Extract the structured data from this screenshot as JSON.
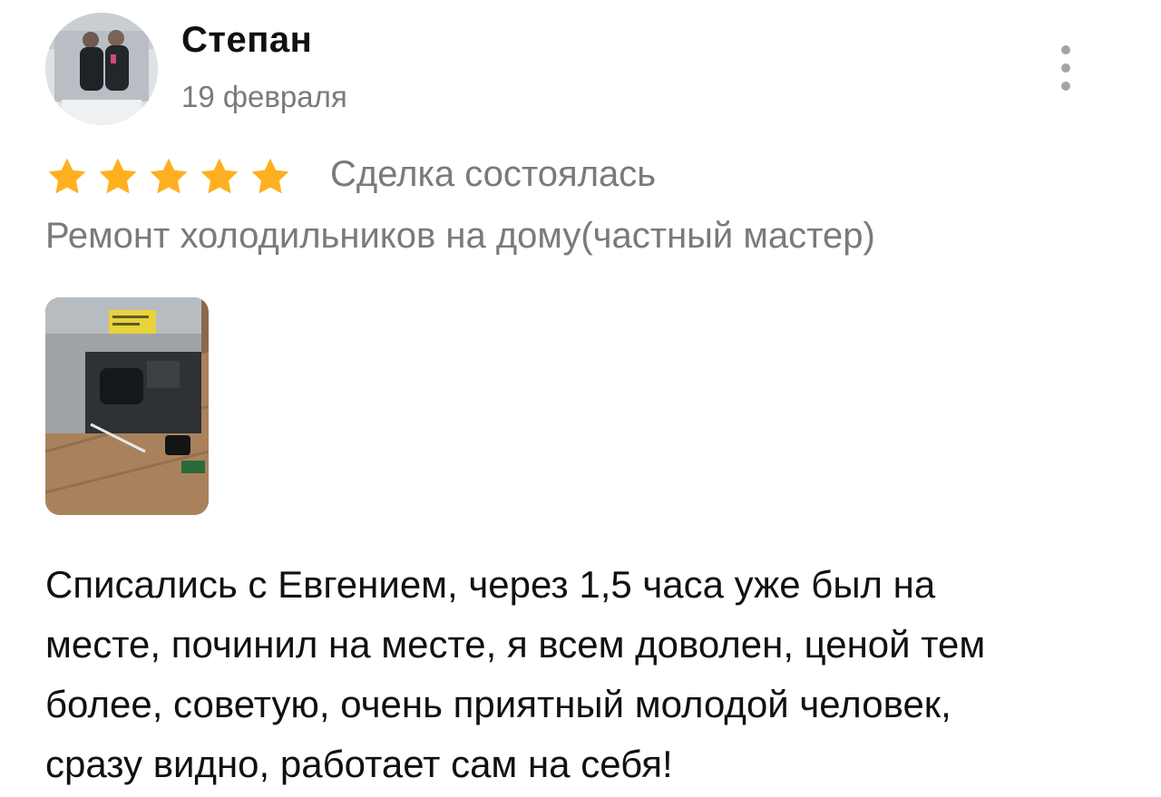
{
  "author": {
    "name": "Степан",
    "avatar_icon": "user-photo-avatar"
  },
  "review": {
    "date": "19 февраля",
    "rating": 5,
    "rating_max": 5,
    "star_color": "#FFB021",
    "deal_status": "Сделка состоялась",
    "service_title": "Ремонт холодильников на дому(частный мастер)",
    "photo_icon": "fridge-repair-photo",
    "text_lines": [
      "Списались с Евгением, через 1,5 часа уже был на",
      "месте, починил на месте, я всем доволен, ценой тем",
      "более, советую, очень приятный молодой человек,",
      "сразу видно, работает сам на себя!"
    ]
  },
  "menu": {
    "icon": "more-vertical-icon"
  },
  "colors": {
    "text_primary": "#111111",
    "text_secondary": "#7a7a7a",
    "menu_dots": "#a4a4a4"
  }
}
